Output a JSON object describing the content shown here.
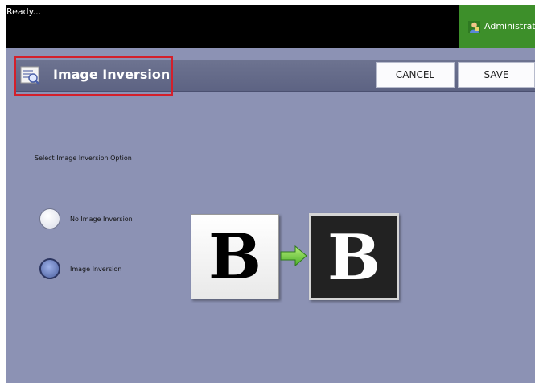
{
  "status": {
    "text": "Ready..."
  },
  "user": {
    "label": "Administrator"
  },
  "header": {
    "title": "Image Inversion",
    "cancel_label": "CANCEL",
    "save_label": "SAVE"
  },
  "main": {
    "prompt": "Select Image Inversion Option",
    "options": [
      {
        "label": "No Image Inversion",
        "selected": false
      },
      {
        "label": "Image Inversion",
        "selected": true
      }
    ],
    "preview": {
      "normal_letter": "B",
      "inverted_letter": "B"
    }
  },
  "colors": {
    "background": "#8c92b4",
    "status_bar": "#000000",
    "admin_area": "#3d8f2a",
    "highlight": "#d3202b"
  },
  "icons": [
    "admin-user-icon",
    "image-inversion-icon",
    "arrow-right-icon"
  ]
}
